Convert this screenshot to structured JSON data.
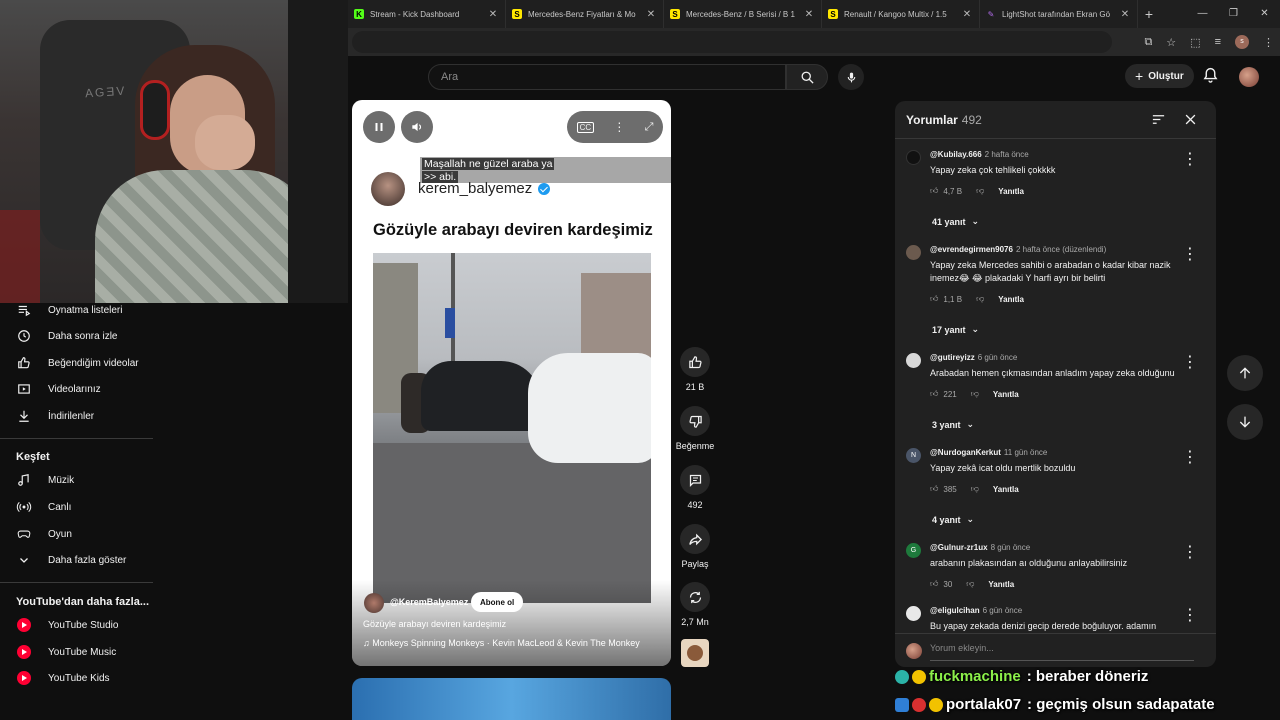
{
  "browser": {
    "tabs": [
      {
        "label": "Stream - Kick Dashboard",
        "favicon": "K",
        "favcolor": "#53fc18"
      },
      {
        "label": "Mercedes-Benz Fiyatları & Mo",
        "favicon": "S",
        "favcolor": "#ffe800"
      },
      {
        "label": "Mercedes-Benz / B Serisi / B 1",
        "favicon": "S",
        "favcolor": "#ffe800"
      },
      {
        "label": "Renault / Kangoo Multix / 1.5",
        "favicon": "S",
        "favcolor": "#ffe800"
      },
      {
        "label": "LightShot tarafından Ekran Gö",
        "favicon": "✎",
        "favcolor": "#b06be8"
      }
    ],
    "profile_letter": "s"
  },
  "header": {
    "search_placeholder": "Ara",
    "create_label": "Oluştur"
  },
  "webcam": {
    "chair_logo": "AGƎV"
  },
  "sidebar": {
    "items_top": [
      {
        "label": "Oynatma listeleri",
        "icon": "playlist-icon"
      },
      {
        "label": "Daha sonra izle",
        "icon": "clock-icon"
      },
      {
        "label": "Beğendiğim videolar",
        "icon": "thumb-up-icon"
      },
      {
        "label": "Videolarınız",
        "icon": "video-icon"
      },
      {
        "label": "İndirilenler",
        "icon": "download-icon"
      }
    ],
    "explore_title": "Keşfet",
    "explore_items": [
      {
        "label": "Müzik",
        "icon": "music-icon"
      },
      {
        "label": "Canlı",
        "icon": "live-icon"
      },
      {
        "label": "Oyun",
        "icon": "gaming-icon"
      },
      {
        "label": "Daha fazla göster",
        "icon": "chevron-down-icon"
      }
    ],
    "more_title": "YouTube'dan daha fazla...",
    "more_items": [
      {
        "label": "YouTube Studio"
      },
      {
        "label": "YouTube Music"
      },
      {
        "label": "YouTube Kids"
      }
    ]
  },
  "short": {
    "caption_line1": "Maşallah ne güzel araba ya",
    "caption_line2": ">> abi.",
    "post_username": "kerem_balyemez",
    "post_title": "Gözüyle arabayı deviren kardeşimiz",
    "channel": "@KeremBalyemez",
    "subscribe_label": "Abone ol",
    "description": "Gözüyle arabayı deviren kardeşimiz",
    "music": "♫ Monkeys Spinning Monkeys · Kevin MacLeod & Kevin The Monkey"
  },
  "actions": {
    "likes": "21 B",
    "dislike_label": "Beğenme",
    "comments": "492",
    "share_label": "Paylaş",
    "remix_count": "2,7 Mn"
  },
  "comments": {
    "title": "Yorumlar",
    "count": "492",
    "input_placeholder": "Yorum ekleyin...",
    "items": [
      {
        "user": "@Kubilay.666",
        "time": "2 hafta önce",
        "text": "Yapay zeka çok tehlikeli çokkkk",
        "likes": "4,7 B",
        "reply_label": "Yanıtla",
        "replies": "41 yanıt",
        "avatar_color": "#111111",
        "avatar_letter": ""
      },
      {
        "user": "@evrendegirmen9076",
        "time": "2 hafta önce (düzenlendi)",
        "text": "Yapay zeka Mercedes sahibi o arabadan o kadar kibar nazik inemez😂 😂 plakadaki  Y harfi ayrı bir belirti",
        "likes": "1,1 B",
        "reply_label": "Yanıtla",
        "replies": "17 yanıt",
        "avatar_color": "#6b5a4e",
        "avatar_letter": ""
      },
      {
        "user": "@gutireyizz",
        "time": "6 gün önce",
        "text": "Arabadan hemen çıkmasından anladım yapay zeka olduğunu",
        "likes": "221",
        "reply_label": "Yanıtla",
        "replies": "3 yanıt",
        "avatar_color": "#d8d8d8",
        "avatar_letter": ""
      },
      {
        "user": "@NurdoganKerkut",
        "time": "11 gün önce",
        "text": "Yapay zekâ icat oldu mertlik bozuldu",
        "likes": "385",
        "reply_label": "Yanıtla",
        "replies": "4 yanıt",
        "avatar_color": "#4a5568",
        "avatar_letter": "N"
      },
      {
        "user": "@Gulnur-zr1ux",
        "time": "8 gün önce",
        "text": "arabanın plakasından aı olduğunu anlayabilirsiniz",
        "likes": "30",
        "reply_label": "Yanıtla",
        "replies": "",
        "avatar_color": "#1e7a3c",
        "avatar_letter": "G"
      },
      {
        "user": "@eligulcihan",
        "time": "6 gün önce",
        "text": "Bu yapay zekada denizi gecip derede boğuluyor. adamın",
        "likes": "",
        "reply_label": "",
        "replies": "",
        "avatar_color": "#e8e8e8",
        "avatar_letter": ""
      }
    ]
  },
  "chat": [
    {
      "user": "fuckmachine",
      "message": ": beraber döneriz"
    },
    {
      "user": "portalak07",
      "message": ": geçmiş olsun sadapatate"
    }
  ]
}
